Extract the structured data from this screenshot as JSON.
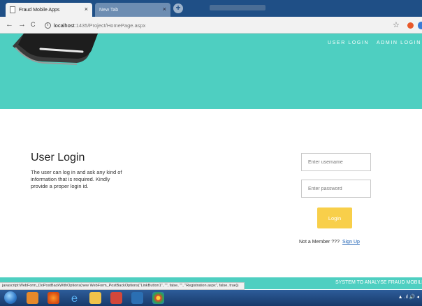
{
  "browser": {
    "tabs": [
      {
        "label": "Fraud Mobile Apps",
        "close": "×"
      },
      {
        "label": "New Tab",
        "close": "×"
      }
    ],
    "new_tab": "+",
    "nav": {
      "back": "←",
      "forward": "→",
      "reload": "C",
      "info": "i"
    },
    "url_host": "localhost",
    "url_path": ":1435/Project/HomePage.aspx",
    "bookmark": "☆"
  },
  "header": {
    "nav": [
      "USER LOGIN",
      "ADMIN LOGIN"
    ]
  },
  "login": {
    "title": "User Login",
    "description": "The user can log in and ask any kind of information that is required. Kindly provide a proper login id.",
    "username_placeholder": "Enter username",
    "password_placeholder": "Enter password",
    "button": "Login",
    "member_text": "Not a Member ???",
    "signup": "Sign Up"
  },
  "footer": {
    "text": "SYSTEM TO ANALYSE FRAUD MOBILE APPS"
  },
  "status": "javascript:WebForm_DoPostBackWithOptions(new WebForm_PostBackOptions(\"LinkButton1\", \"\", false, \"\", \"Registration.aspx\", false, true))",
  "taskbar": {
    "tray": "▲ .ıl 🔊 ◂"
  },
  "colors": {
    "accent": "#4ecfc1",
    "button": "#f8cf4a",
    "link": "#1a5fb4"
  }
}
